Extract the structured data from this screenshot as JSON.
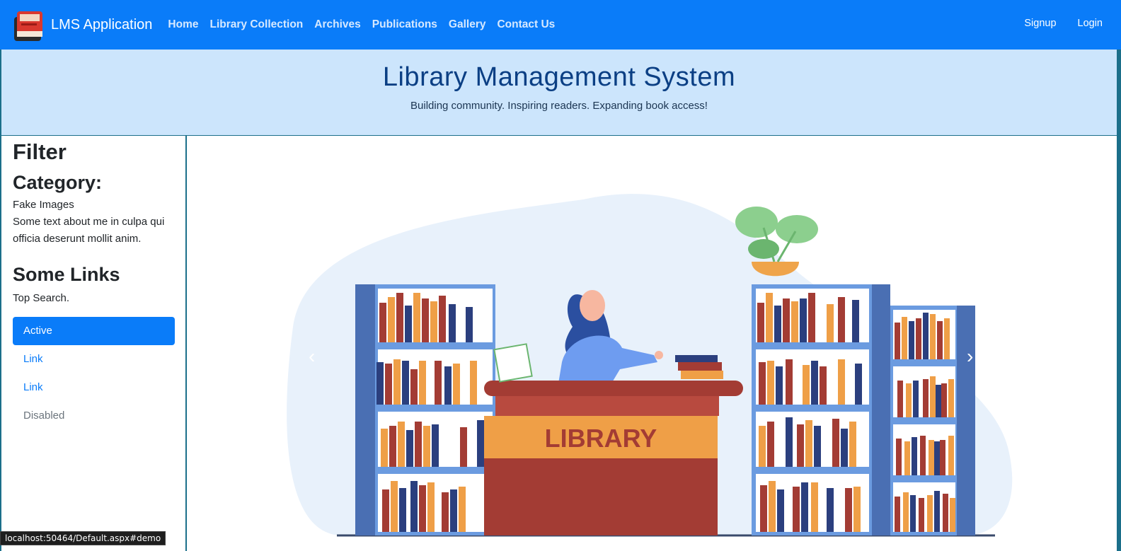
{
  "navbar": {
    "brand": "LMS Application",
    "links": [
      "Home",
      "Library Collection",
      "Archives",
      "Publications",
      "Gallery",
      "Contact Us"
    ],
    "right_links": [
      "Signup",
      "Login"
    ],
    "color": "#0a7cf9"
  },
  "hero": {
    "title": "Library Management System",
    "subtitle": "Building community. Inspiring readers. Expanding book access!"
  },
  "sidebar": {
    "title": "Filter",
    "category_heading": "Category:",
    "category_text_1": "Fake Images",
    "category_text_2": "Some text about me in culpa qui officia deserunt mollit anim.",
    "links_heading": "Some Links",
    "top_search": "Top Search.",
    "pills": [
      "Active",
      "Link",
      "Link",
      "Disabled"
    ]
  },
  "carousel": {
    "sign_text": "LIBRARY",
    "prev_icon": "chevron-left-icon",
    "next_icon": "chevron-right-icon"
  },
  "status": {
    "url": "localhost:50464/Default.aspx#demo"
  }
}
